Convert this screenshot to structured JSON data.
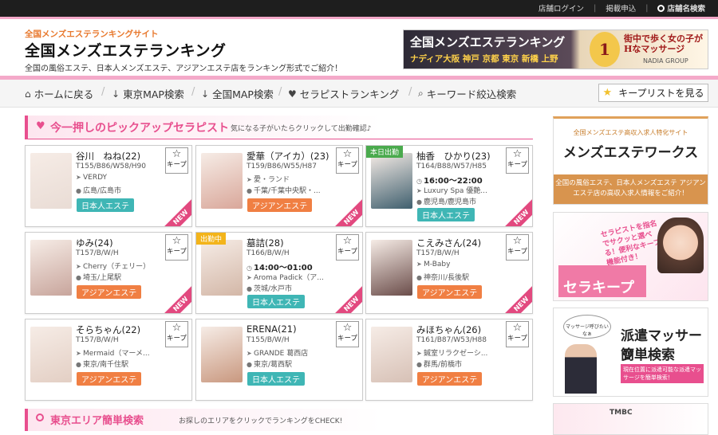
{
  "topbar": {
    "login": "店舗ログイン",
    "apply": "掲載申込",
    "search": "店舗名検索"
  },
  "header": {
    "subtitle": "全国メンズエステランキングサイト",
    "title": "全国メンズエステランキング",
    "description": "全国の風俗エステ、日本人メンズエステ、アジアンエステ店をランキング形式でご紹介！",
    "banner": {
      "title": "全国メンズエステランキング",
      "cities": "ナディア大阪 神戸 京都 東京 新橋 上野",
      "rank": "1位!",
      "catch": "街中で歩く女の子が Hなマッサージ",
      "group": "NADIA GROUP"
    }
  },
  "nav": {
    "items": [
      "ホームに戻る",
      "東京MAP検索",
      "全国MAP検索",
      "セラピストランキング",
      "キーワード絞込検索"
    ],
    "keep_list": "キープリストを見る"
  },
  "pickup": {
    "title": "今一押しのピックアップセラピスト",
    "subtitle": "気になる子がいたらクリックして出勤確認♪",
    "keep_label": "キープ",
    "new_label": "NEW",
    "cards": [
      {
        "name": "谷川　ねね(22)",
        "spec": "T155/B86/W58/H90",
        "time": "",
        "shop": "VERDY",
        "area": "広島/広島市",
        "category": "日本人エステ",
        "badge": "",
        "new": true,
        "photo": "#e9dcd5"
      },
      {
        "name": "愛華（アイカ）(23)",
        "spec": "T159/B86/W55/H87",
        "time": "",
        "shop": "愛・ランド",
        "area": "千葉/千葉中央駅・...",
        "category": "アジアンエステ",
        "badge": "",
        "new": true,
        "photo": "#d9a79a"
      },
      {
        "name": "柚香　ひかり(23)",
        "spec": "T164/B88/W57/H85",
        "time": "16:00～22:00",
        "shop": "Luxury Spa 優艶...",
        "area": "鹿児島/鹿児島市",
        "category": "日本人エステ",
        "badge": "本日出勤",
        "new": true,
        "photo": "#3f5f6e"
      },
      {
        "name": "ゆみ(24)",
        "spec": "T157/B/W/H",
        "time": "",
        "shop": "Cherry（チェリー）",
        "area": "埼玉/上尾駅",
        "category": "アジアンエステ",
        "badge": "",
        "new": true,
        "photo": "#c8a59c"
      },
      {
        "name": "墓詰(28)",
        "spec": "T166/B/W/H",
        "time": "14:00～01:00",
        "shop": "Aroma Padick（ア...",
        "area": "茨城/水戸市",
        "category": "日本人エステ",
        "badge": "出勤中",
        "new": true,
        "photo": "#d3b7a7"
      },
      {
        "name": "こえみさん(24)",
        "spec": "T157/B/W/H",
        "time": "",
        "shop": "M-Baby",
        "area": "神奈川/長後駅",
        "category": "アジアンエステ",
        "badge": "",
        "new": true,
        "photo": "#6b4d4a"
      },
      {
        "name": "そらちゃん(22)",
        "spec": "T157/B/W/H",
        "time": "",
        "shop": "Mermaid（マーメ...",
        "area": "東京/南千住駅",
        "category": "アジアンエステ",
        "badge": "",
        "new": false,
        "photo": "#e3cfc4"
      },
      {
        "name": "ERENA(21)",
        "spec": "T155/B/W/H",
        "time": "",
        "shop": "GRANDE 葛西店",
        "area": "東京/葛西駅",
        "category": "日本人エステ",
        "badge": "",
        "new": false,
        "photo": "#c9987f"
      },
      {
        "name": "みほちゃん(26)",
        "spec": "T161/B87/W53/H88",
        "time": "",
        "shop": "鍼室リラクゼーシ...",
        "area": "群馬/前橋市",
        "category": "アジアンエステ",
        "badge": "",
        "new": false,
        "photo": "#d7c1b6"
      }
    ]
  },
  "east": {
    "title": "東京エリア簡単検索",
    "subtitle": "お探しのエリアをクリックでランキングをCHECK!"
  },
  "sidebar": {
    "recruit_small": "全国メンズエステ高収入求人特化サイト",
    "recruit_big": "メンズエステワークス",
    "recruit_foot": "全国の風俗エステ、日本人メンズエステ アジアンエステ店の高収入求人情報をご紹介！",
    "therakeep_note": "セラピストを指名でサクッと選べる！便利なキープ機能付き！",
    "therakeep_title": "セラキープ",
    "dispatch_bubble": "マッサージ呼びたいなぁ",
    "dispatch_title1": "派遣マッサージ",
    "dispatch_title2": "簡単検索",
    "dispatch_note": "現在位置に派遣可能な派遣マッサージを簡単検索！",
    "tmbc": "TMBC"
  },
  "colors": {
    "accent_pink": "#e84f8e",
    "japanese_tag": "#3fb6b5",
    "asian_tag": "#f07f43",
    "today_badge": "#4aaa4d",
    "working_badge": "#f3b41b"
  }
}
